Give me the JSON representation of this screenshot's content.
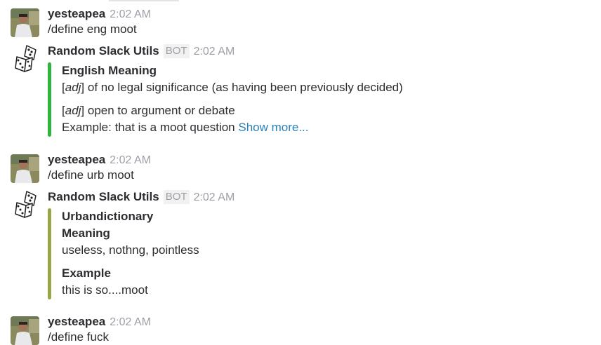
{
  "colors": {
    "english_bar": "#2fb43f",
    "urban_bar": "#9aa54a",
    "link": "#2a80b9",
    "timestamp": "#9e9ea6"
  },
  "messages": [
    {
      "type": "user",
      "avatar_icon": "user-photo-avatar",
      "username": "yesteapea",
      "time": "2:02 AM",
      "text": "/define eng moot"
    },
    {
      "type": "bot",
      "avatar_icon": "dice-icon",
      "username": "Random Slack Utils",
      "bot_badge": "BOT",
      "time": "2:02 AM",
      "attachment": {
        "title": "English Meaning",
        "def1_pos": "adj",
        "def1_text": " of no legal significance (as having been previously decided)",
        "def2_pos": "adj",
        "def2_text": " open to argument or debate",
        "example_text": "Example: that is a moot question ",
        "show_more": "Show more..."
      }
    },
    {
      "type": "user",
      "avatar_icon": "user-photo-avatar",
      "username": "yesteapea",
      "time": "2:02 AM",
      "text": "/define urb moot"
    },
    {
      "type": "bot",
      "avatar_icon": "dice-icon",
      "username": "Random Slack Utils",
      "bot_badge": "BOT",
      "time": "2:02 AM",
      "attachment": {
        "title_line1": "Urbandictionary",
        "title_line2": "Meaning",
        "meaning": "useless, nothng, pointless",
        "example_label": "Example",
        "example": "this is so....moot"
      }
    },
    {
      "type": "user",
      "avatar_icon": "user-photo-avatar",
      "username": "yesteapea",
      "time": "2:02 AM",
      "text": "/define fuck"
    }
  ]
}
